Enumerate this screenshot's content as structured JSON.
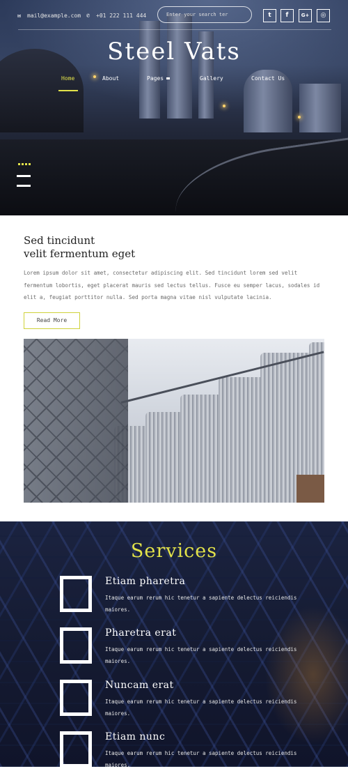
{
  "topbar": {
    "email": "mail@example.com",
    "phone": "+01 222 111 444",
    "search_placeholder": "Enter your search ter",
    "social": [
      {
        "icon": "twitter-icon",
        "glyph": "t"
      },
      {
        "icon": "facebook-icon",
        "glyph": "f"
      },
      {
        "icon": "google-plus-icon",
        "glyph": "G+"
      },
      {
        "icon": "dribbble-icon",
        "glyph": "◎"
      }
    ]
  },
  "brand": {
    "logo": "Steel Vats"
  },
  "nav": {
    "items": [
      {
        "label": "Home",
        "active": true
      },
      {
        "label": "About"
      },
      {
        "label": "Pages"
      },
      {
        "label": "Gallery"
      },
      {
        "label": "Contact Us"
      }
    ]
  },
  "about": {
    "title_line1": "Sed tincidunt",
    "title_line2": "velit fermentum eget",
    "text": "Lorem ipsum dolor sit amet, consectetur adipiscing elit. Sed tincidunt lorem sed velit fermentum lobortis, eget placerat mauris sed lectus tellus. Fusce eu semper lacus, sodales id elit a, feugiat porttitor nulla. Sed porta magna vitae nisl vulputate lacinia.",
    "button": "Read More"
  },
  "services": {
    "title": "Services",
    "items": [
      {
        "name": "Etiam pharetra",
        "desc": "Itaque earum rerum hic tenetur a sapiente delectus reiciendis maiores."
      },
      {
        "name": "Pharetra erat",
        "desc": "Itaque earum rerum hic tenetur a sapiente delectus reiciendis maiores."
      },
      {
        "name": "Nuncam erat",
        "desc": "Itaque earum rerum hic tenetur a sapiente delectus reiciendis maiores."
      },
      {
        "name": "Etiam nunc",
        "desc": "Itaque earum rerum hic tenetur a sapiente delectus reiciendis maiores."
      }
    ]
  },
  "colors": {
    "accent": "#e2e24a",
    "button_border": "#cfd23a",
    "services_bg": "#151b32"
  }
}
